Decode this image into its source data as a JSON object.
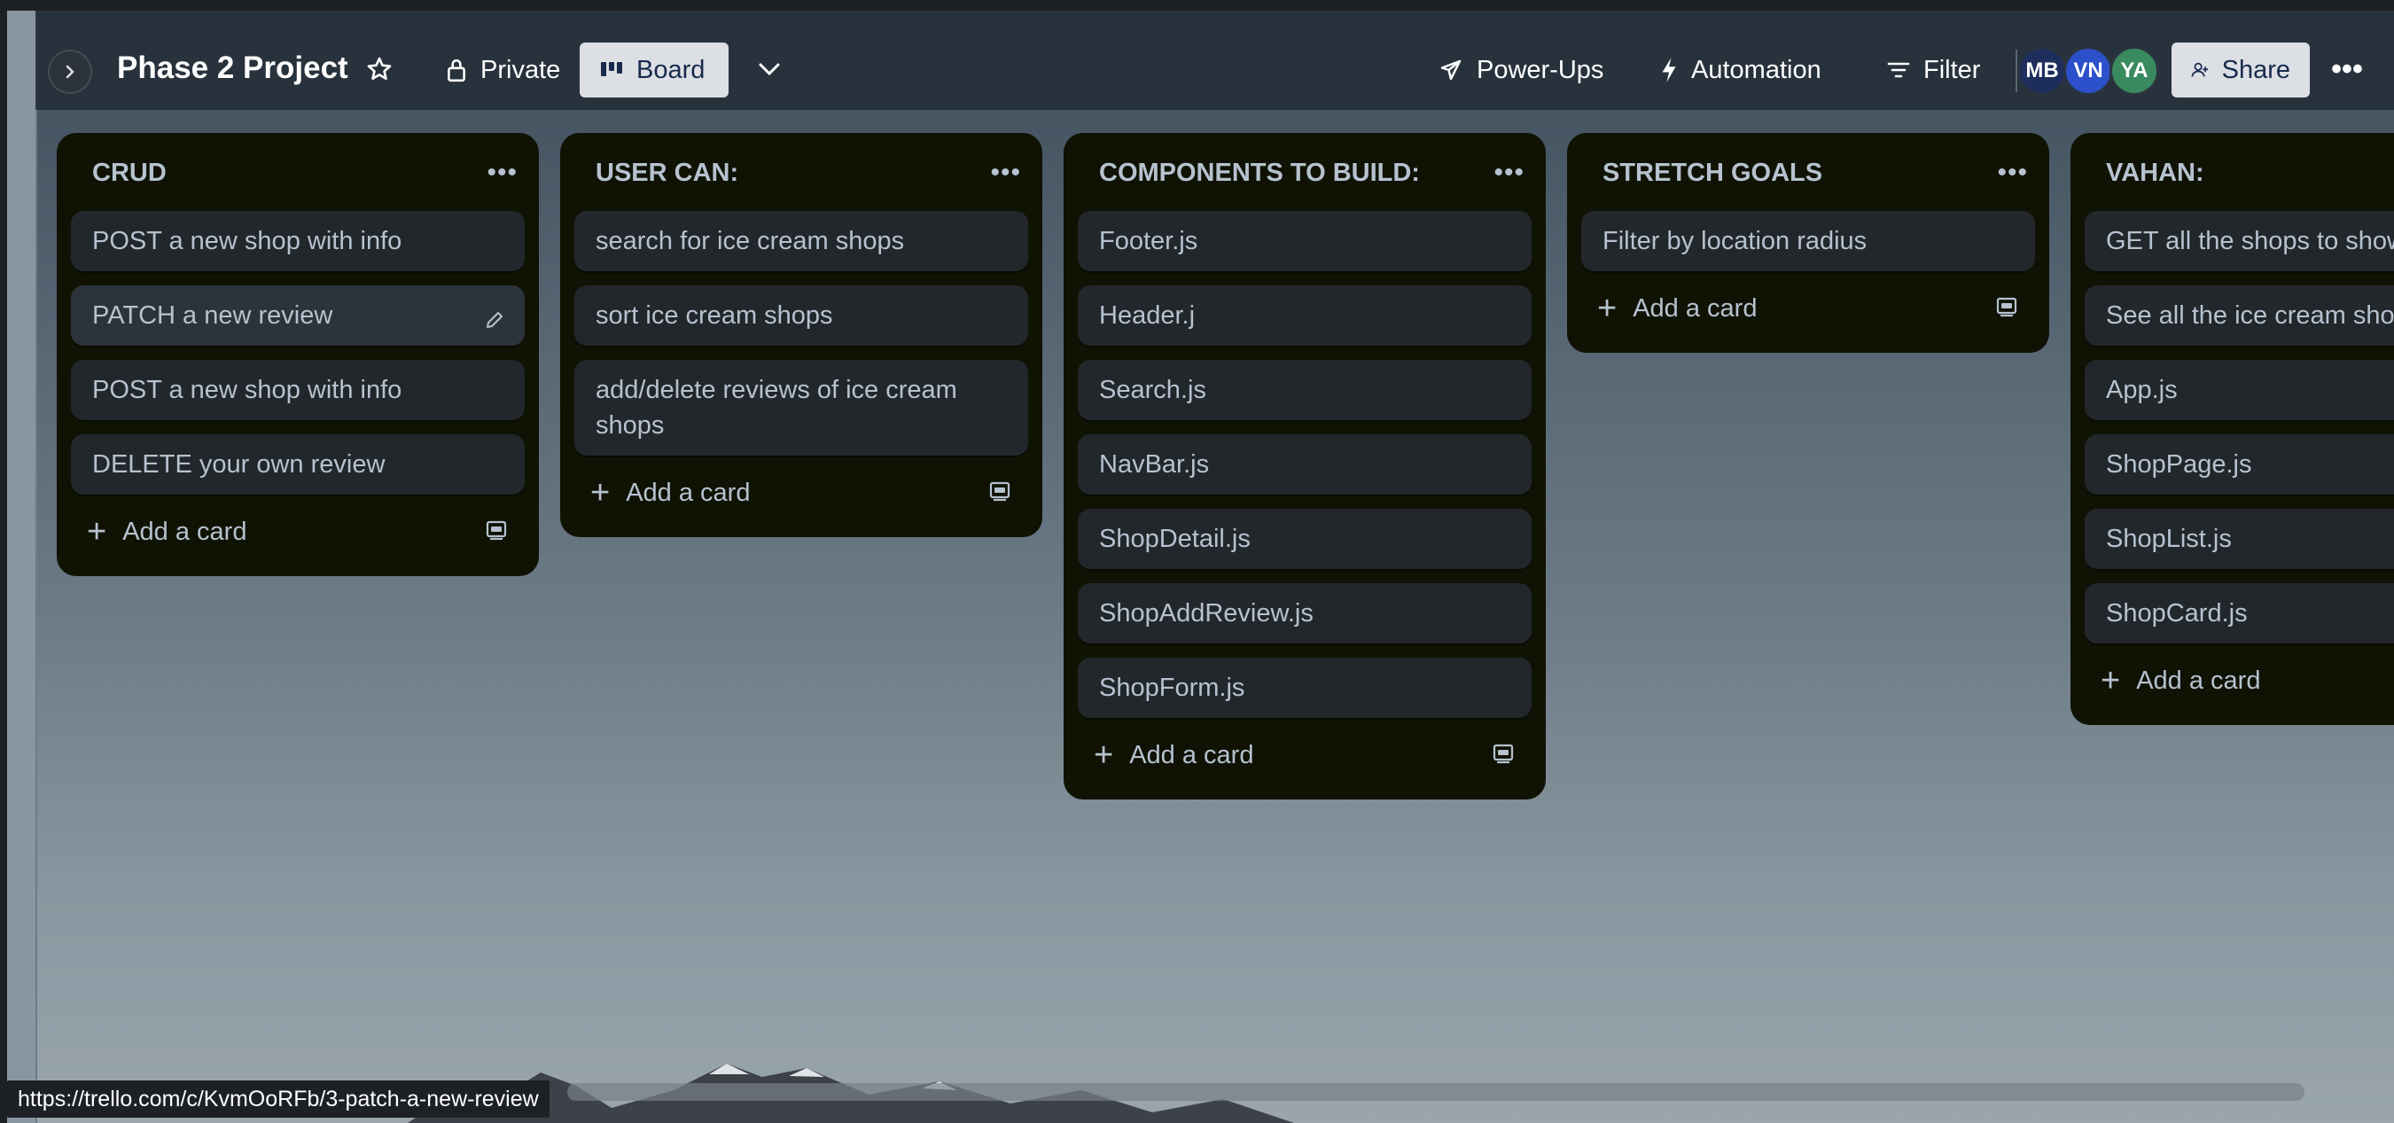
{
  "header": {
    "board_title": "Phase 2 Project",
    "visibility_label": "Private",
    "view_label": "Board",
    "powerups_label": "Power-Ups",
    "automation_label": "Automation",
    "filter_label": "Filter",
    "share_label": "Share",
    "members": [
      {
        "initials": "MB",
        "color": "#1d2d5c"
      },
      {
        "initials": "VN",
        "color": "#2b50c9"
      },
      {
        "initials": "YA",
        "color": "#3a8a5f"
      }
    ]
  },
  "lists": [
    {
      "title": "CRUD",
      "cards": [
        "POST a new shop with info",
        "PATCH a new review",
        "POST a new shop with info",
        "DELETE your own review"
      ],
      "add_card_label": "Add a card"
    },
    {
      "title": "USER CAN:",
      "cards": [
        "search for ice cream shops",
        "sort ice cream shops",
        "add/delete reviews of ice cream shops"
      ],
      "add_card_label": "Add a card"
    },
    {
      "title": "COMPONENTS TO BUILD:",
      "cards": [
        "Footer.js",
        "Header.j",
        "Search.js",
        "NavBar.js",
        "ShopDetail.js",
        "ShopAddReview.js",
        "ShopForm.js"
      ],
      "add_card_label": "Add a card"
    },
    {
      "title": "STRETCH GOALS",
      "cards": [
        "Filter by location radius"
      ],
      "add_card_label": "Add a card"
    },
    {
      "title": "VAHAN:",
      "cards": [
        "GET all the shops to show",
        "See all the ice cream sho",
        "App.js",
        "ShopPage.js",
        "ShopList.js",
        "ShopCard.js"
      ],
      "add_card_label": "Add a card"
    }
  ],
  "status_url": "https://trello.com/c/KvmOoRFb/3-patch-a-new-review"
}
